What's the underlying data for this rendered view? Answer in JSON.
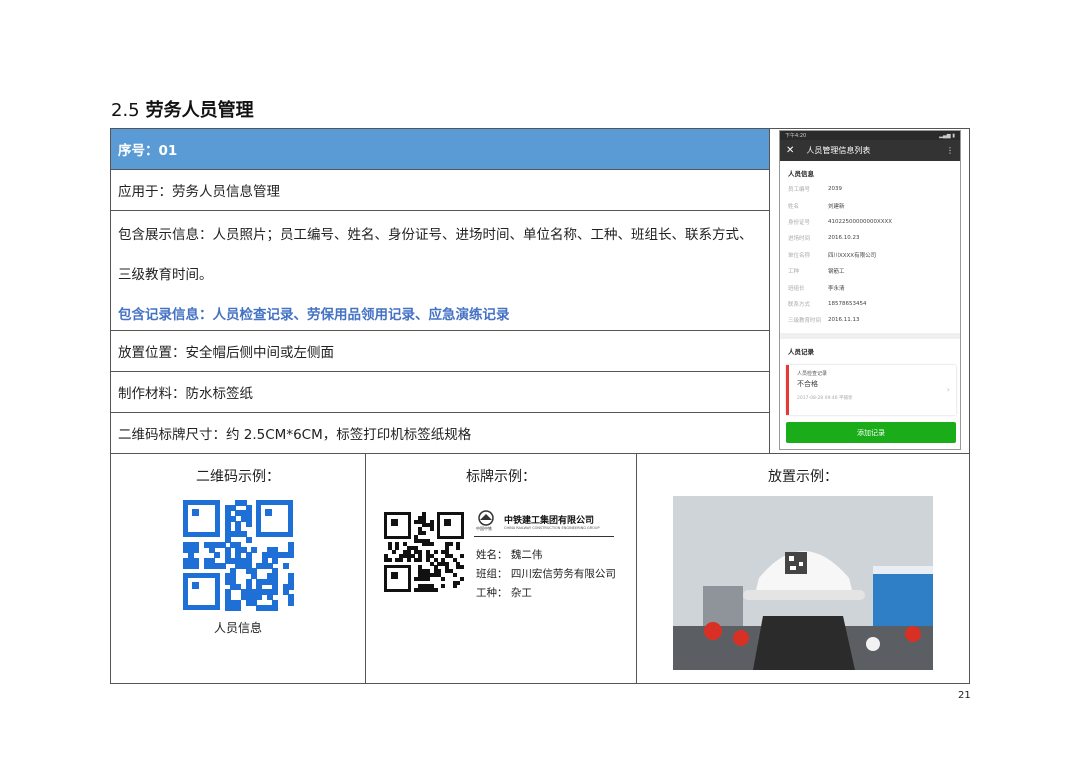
{
  "section": {
    "number": "2.5",
    "title": "劳务人员管理"
  },
  "rows": {
    "serial": "序号：01",
    "applies_to": "应用于：劳务人员信息管理",
    "display_info_1": "包含展示信息：人员照片；员工编号、姓名、身份证号、进场时间、单位名称、工种、班组长、联系方式、",
    "display_info_2": "三级教育时间。",
    "records_info": "包含记录信息：人员检查记录、劳保用品领用记录、应急演练记录",
    "placement": "放置位置：安全帽后侧中间或左侧面",
    "material": "制作材料：防水标签纸",
    "size": "二维码标牌尺寸：约 2.5CM*6CM，标签打印机标签纸规格"
  },
  "phone": {
    "status_time": "下午4:20",
    "title": "人员管理信息列表",
    "close_icon": "close-icon",
    "menu_icon": "more-vertical-icon",
    "info_section": "人员信息",
    "fields": [
      {
        "k": "员工编号",
        "v": "2039"
      },
      {
        "k": "姓名",
        "v": "刘建新"
      },
      {
        "k": "身份证号",
        "v": "41022500000000XXXX"
      },
      {
        "k": "进场时间",
        "v": "2016.10.23"
      },
      {
        "k": "单位名称",
        "v": "四川XXXX有限公司"
      },
      {
        "k": "工种",
        "v": "钢筋工"
      },
      {
        "k": "班组长",
        "v": "李永清"
      },
      {
        "k": "联系方式",
        "v": "18578653454"
      },
      {
        "k": "三级教育时间",
        "v": "2016.11.13"
      }
    ],
    "records_section": "人员记录",
    "record": {
      "type": "人员检查记录",
      "result": "不合格",
      "meta": "2017-08-28  09:46   平铺状"
    },
    "add_button": "添加记录"
  },
  "bottom": {
    "qr_header": "二维码示例：",
    "badge_header": "标牌示例：",
    "placement_header": "放置示例：",
    "qr_caption": "人员信息",
    "badge": {
      "company": "中铁建工集团有限公司",
      "company_en": "CHINA RAILWAY CONSTRUCTION ENGINEERING GROUP",
      "brand": "中国中铁",
      "name": "姓名：  魏二伟",
      "team": "班组：  四川宏信劳务有限公司",
      "trade": "工种：  杂工"
    }
  },
  "colors": {
    "header_bg": "#5b9bd5",
    "accent_text": "#4472c4",
    "qr_blue": "#1e6fd6",
    "add_button": "#1aad19",
    "record_flag": "#e53935"
  },
  "page_number": "21"
}
